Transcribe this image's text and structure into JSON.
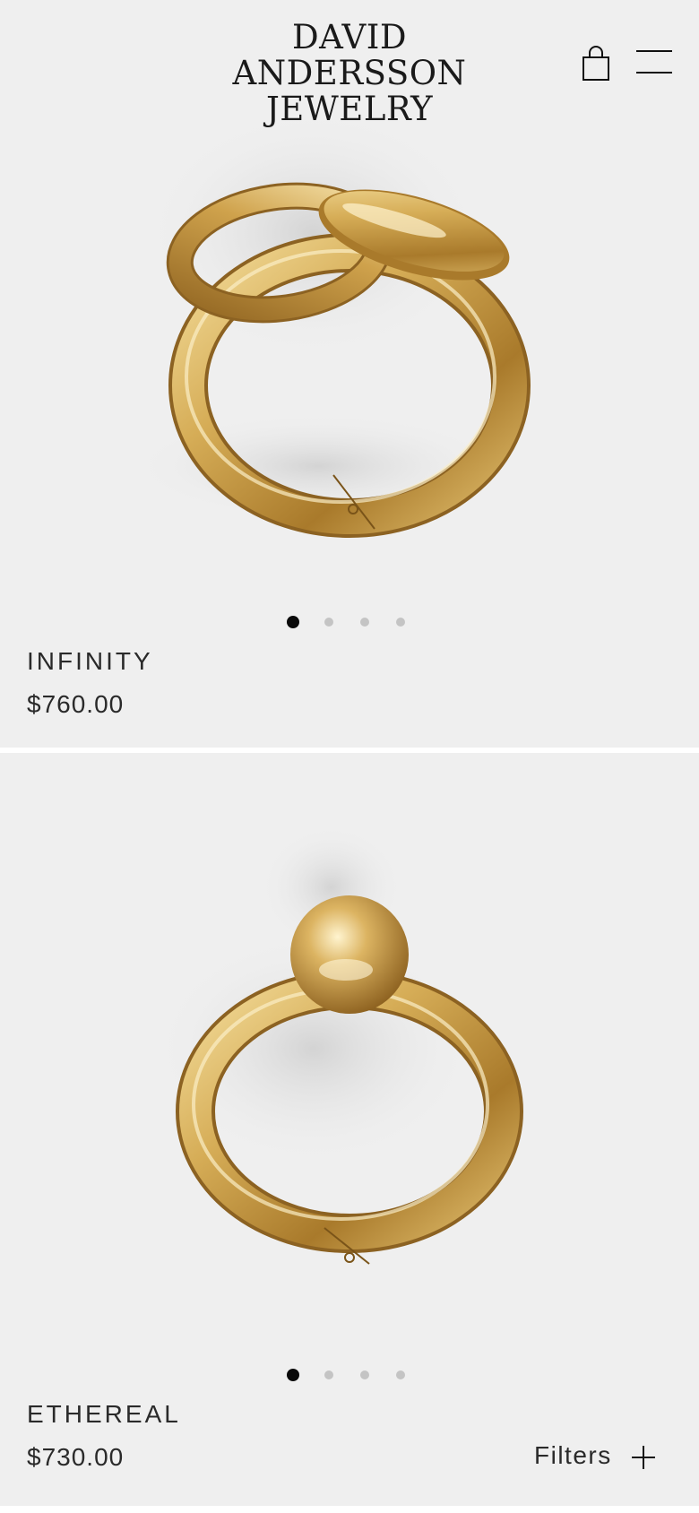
{
  "brand": {
    "line1": "DAVID",
    "line2": "ANDERSSON",
    "line3": "JEWELRY"
  },
  "header": {
    "cart_icon": "shopping-bag-icon",
    "menu_icon": "hamburger-menu-icon"
  },
  "products": [
    {
      "name": "INFINITY",
      "price": "$760.00",
      "image_count": 4,
      "active_image": 1
    },
    {
      "name": "ETHEREAL",
      "price": "$730.00",
      "image_count": 4,
      "active_image": 1
    }
  ],
  "filters": {
    "label": "Filters",
    "icon": "plus-icon"
  },
  "colors": {
    "card_background": "#efefef",
    "gold": "#c99a3f",
    "dot_active": "#0a0a0a",
    "dot_inactive": "#c4c4c4"
  }
}
